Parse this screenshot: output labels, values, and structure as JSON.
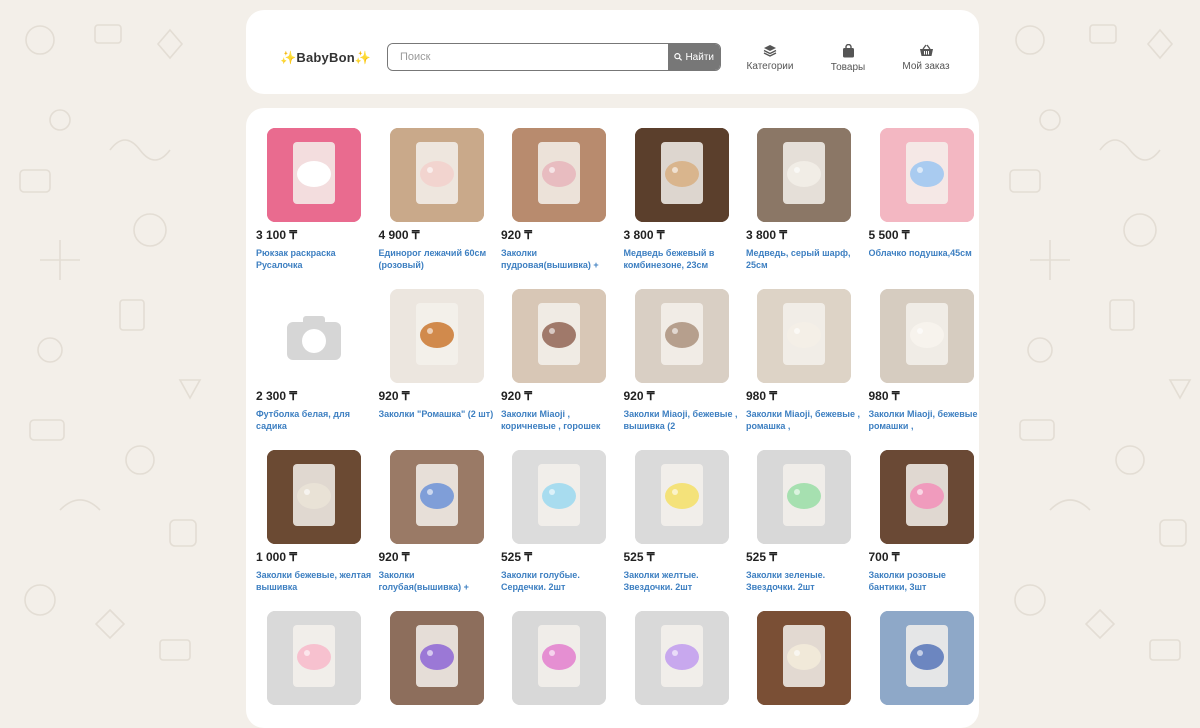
{
  "header": {
    "logo": "✨BabyBon✨",
    "search_placeholder": "Поиск",
    "search_button": "Найти",
    "nav": [
      {
        "label": "Категории",
        "icon": "layers-icon"
      },
      {
        "label": "Товары",
        "icon": "bag-icon"
      },
      {
        "label": "Мой заказ",
        "icon": "basket-icon"
      }
    ]
  },
  "currency": "₸",
  "products": [
    {
      "price": "3 100 ₸",
      "title": "Рюкзак раскраска Русалочка",
      "bg": "#e96b8f",
      "fg": "#ffffff"
    },
    {
      "price": "4 900 ₸",
      "title": "Единорог лежачий 60см (розовый)",
      "bg": "#c9a98a",
      "fg": "#f2d4cf"
    },
    {
      "price": "920 ₸",
      "title": "Заколки пудровая(вышивка) +",
      "bg": "#b88b6e",
      "fg": "#e8bcc0"
    },
    {
      "price": "3 800 ₸",
      "title": "Медведь бежевый в комбинезоне, 23см",
      "bg": "#5b3f2c",
      "fg": "#d9b58d"
    },
    {
      "price": "3 800 ₸",
      "title": "Медведь, серый шарф, 25см",
      "bg": "#8b7766",
      "fg": "#f1ede6"
    },
    {
      "price": "5 500 ₸",
      "title": "Облачко подушка,45см",
      "bg": "#f3b7c2",
      "fg": "#a9cbf0"
    },
    {
      "price": "2 300 ₸",
      "title": "Футболка белая, для садика",
      "bg": "#ffffff",
      "fg": "#d6d6d6"
    },
    {
      "price": "920 ₸",
      "title": "Заколки \"Ромашка\" (2 шт)",
      "bg": "#ece6df",
      "fg": "#d18a4c"
    },
    {
      "price": "920 ₸",
      "title": "Заколки Miaoji , коричневые , горошек",
      "bg": "#d8c7b6",
      "fg": "#a0796a"
    },
    {
      "price": "920 ₸",
      "title": "Заколки Miaoji, бежевые , вышивка (2",
      "bg": "#d9cfc4",
      "fg": "#b69f8d"
    },
    {
      "price": "980 ₸",
      "title": "Заколки Miaoji, бежевые , ромашка ,",
      "bg": "#ddd3c6",
      "fg": "#f4efe7"
    },
    {
      "price": "980 ₸",
      "title": "Заколки Miaoji, бежевые , ромашки ,",
      "bg": "#d6ccc0",
      "fg": "#f7f3ed"
    },
    {
      "price": "1 000 ₸",
      "title": "Заколки бежевые, желтая вышивка",
      "bg": "#6b4a33",
      "fg": "#e9e2d6"
    },
    {
      "price": "920 ₸",
      "title": "Заколки голубая(вышивка) +",
      "bg": "#9a7a66",
      "fg": "#7f9ed8"
    },
    {
      "price": "525 ₸",
      "title": "Заколки голубые. Сердечки. 2шт",
      "bg": "#dcdcdc",
      "fg": "#a8dcef"
    },
    {
      "price": "525 ₸",
      "title": "Заколки желтые. Звездочки. 2шт",
      "bg": "#dadada",
      "fg": "#f4e27a"
    },
    {
      "price": "525 ₸",
      "title": "Заколки зеленые. Звездочки. 2шт",
      "bg": "#d8d8d8",
      "fg": "#a6e0b0"
    },
    {
      "price": "700 ₸",
      "title": "Заколки розовые бантики, 3шт",
      "bg": "#6a4935",
      "fg": "#f09bbd"
    },
    {
      "price": "",
      "title": "",
      "bg": "#d9d9d9",
      "fg": "#f7c1cf"
    },
    {
      "price": "",
      "title": "",
      "bg": "#8d6e5c",
      "fg": "#9b78d6"
    },
    {
      "price": "",
      "title": "",
      "bg": "#d8d8d8",
      "fg": "#e58fd2"
    },
    {
      "price": "",
      "title": "",
      "bg": "#d9d9d9",
      "fg": "#c8a8ee"
    },
    {
      "price": "",
      "title": "",
      "bg": "#7a4f35",
      "fg": "#f1e9d9"
    },
    {
      "price": "",
      "title": "",
      "bg": "#8ea8c8",
      "fg": "#6c86c0"
    }
  ]
}
